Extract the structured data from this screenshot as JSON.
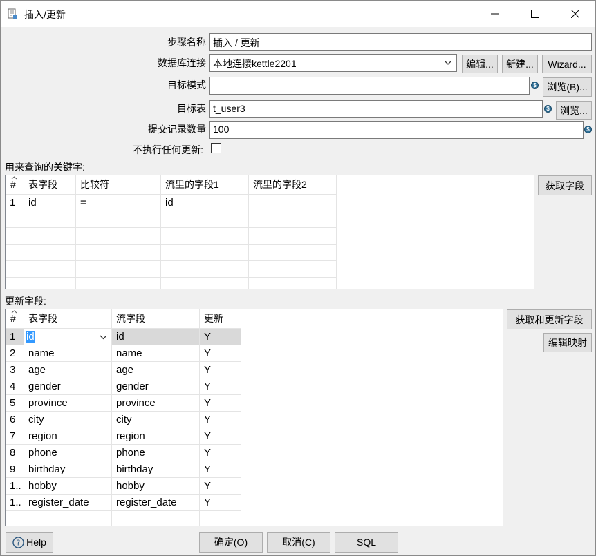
{
  "window": {
    "title": "插入/更新"
  },
  "form": {
    "step_name_label": "步骤名称",
    "step_name_value": "插入 / 更新",
    "db_conn_label": "数据库连接",
    "db_conn_value": "本地连接kettle2201",
    "edit_button": "编辑...",
    "new_button": "新建...",
    "wizard_button": "Wizard...",
    "target_schema_label": "目标模式",
    "target_schema_value": "",
    "browse_schema_button": "浏览(B)...",
    "target_table_label": "目标表",
    "target_table_value": "t_user3",
    "browse_table_button": "浏览...",
    "commit_size_label": "提交记录数量",
    "commit_size_value": "100",
    "no_update_label": "不执行任何更新:",
    "no_update_checked": false
  },
  "keys": {
    "section_label": "用来查询的关键字:",
    "get_fields_button": "获取字段",
    "columns": [
      "#",
      "表字段",
      "比较符",
      "流里的字段1",
      "流里的字段2"
    ],
    "rows": [
      {
        "num": "1",
        "table_field": "id",
        "comparator": "=",
        "stream_field1": "id",
        "stream_field2": ""
      }
    ]
  },
  "update": {
    "section_label": "更新字段:",
    "get_update_button": "获取和更新字段",
    "edit_mapping_button": "编辑映射",
    "columns": [
      "#",
      "表字段",
      "流字段",
      "更新"
    ],
    "rows": [
      {
        "num": "1",
        "table_field": "id",
        "stream_field": "id",
        "update": "Y"
      },
      {
        "num": "2",
        "table_field": "name",
        "stream_field": "name",
        "update": "Y"
      },
      {
        "num": "3",
        "table_field": "age",
        "stream_field": "age",
        "update": "Y"
      },
      {
        "num": "4",
        "table_field": "gender",
        "stream_field": "gender",
        "update": "Y"
      },
      {
        "num": "5",
        "table_field": "province",
        "stream_field": "province",
        "update": "Y"
      },
      {
        "num": "6",
        "table_field": "city",
        "stream_field": "city",
        "update": "Y"
      },
      {
        "num": "7",
        "table_field": "region",
        "stream_field": "region",
        "update": "Y"
      },
      {
        "num": "8",
        "table_field": "phone",
        "stream_field": "phone",
        "update": "Y"
      },
      {
        "num": "9",
        "table_field": "birthday",
        "stream_field": "birthday",
        "update": "Y"
      },
      {
        "num": "1..",
        "table_field": "hobby",
        "stream_field": "hobby",
        "update": "Y"
      },
      {
        "num": "1..",
        "table_field": "register_date",
        "stream_field": "register_date",
        "update": "Y"
      }
    ]
  },
  "footer": {
    "help_button": "Help",
    "ok_button": "确定(O)",
    "cancel_button": "取消(C)",
    "sql_button": "SQL"
  },
  "icons": {
    "variable": "dollar-variable-icon",
    "help": "help-circle-icon"
  },
  "colors": {
    "selection": "#3399ff",
    "variable_icon": "#2f6f96"
  }
}
